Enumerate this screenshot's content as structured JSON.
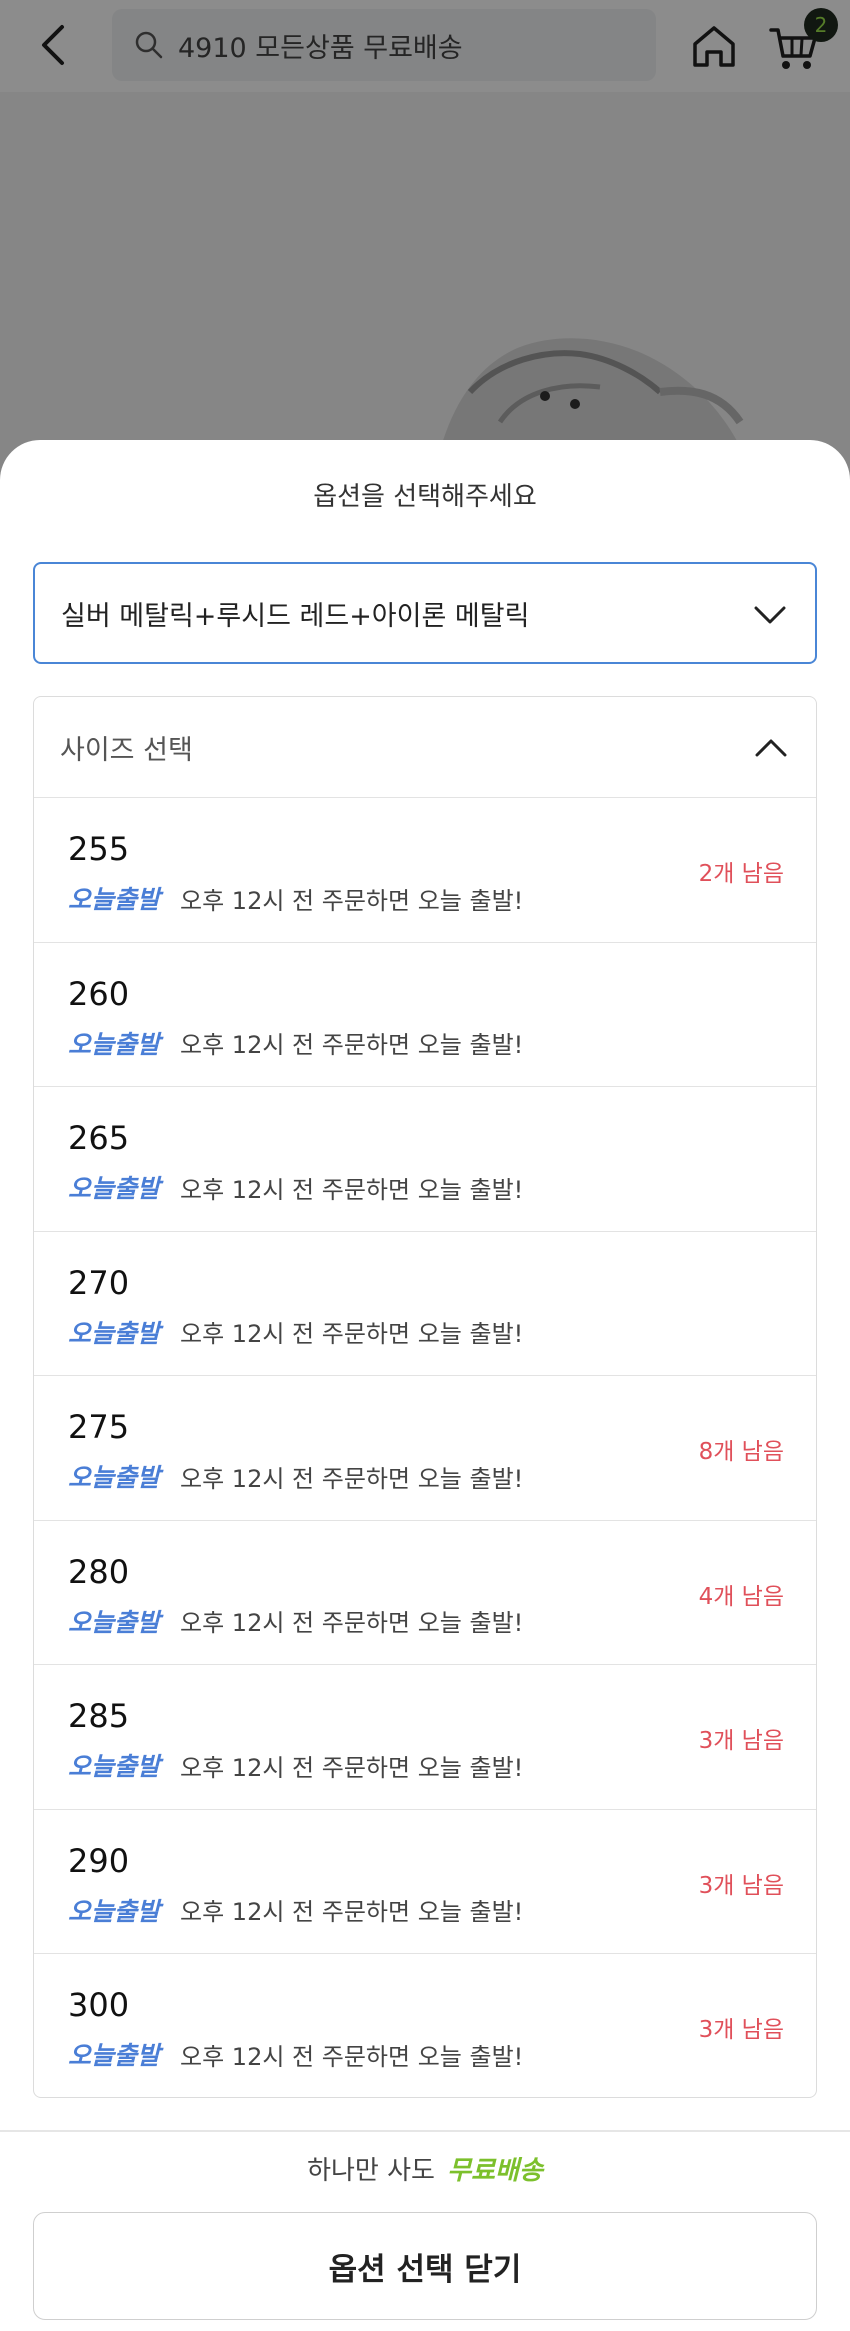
{
  "header": {
    "search_placeholder": "4910 모든상품 무료배송",
    "cart_count": "2"
  },
  "sheet": {
    "title": "옵션을 선택해주세요",
    "color_option": "실버 메탈릭+루시드 레드+아이론 메탈릭",
    "size_header": "사이즈 선택",
    "today_badge": "오늘출발",
    "delivery_text": "오후 12시 전 주문하면 오늘 출발!",
    "sizes": [
      {
        "size": "255",
        "stock": "2개 남음"
      },
      {
        "size": "260",
        "stock": ""
      },
      {
        "size": "265",
        "stock": ""
      },
      {
        "size": "270",
        "stock": ""
      },
      {
        "size": "275",
        "stock": "8개 남음"
      },
      {
        "size": "280",
        "stock": "4개 남음"
      },
      {
        "size": "285",
        "stock": "3개 남음"
      },
      {
        "size": "290",
        "stock": "3개 남음"
      },
      {
        "size": "300",
        "stock": "3개 남음"
      }
    ],
    "free_shipping_prefix": "하나만 사도",
    "free_shipping_word": "무료배송",
    "close_button": "옵션 선택 닫기"
  },
  "colors": {
    "accent_blue": "#4a86d6",
    "stock_red": "#e0505a",
    "free_green": "#7cc02c"
  }
}
